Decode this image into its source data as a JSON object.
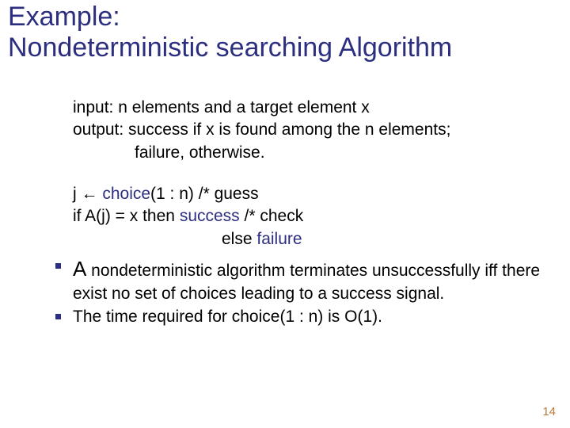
{
  "title_line1": "Example:",
  "title_line2": "Nondeterministic searching Algorithm",
  "io": {
    "input": "input:  n elements and a target element x",
    "output_l1": "output: success if x is found among the n elements;",
    "output_l2": "failure, otherwise."
  },
  "algo": {
    "l1_a": "j ← ",
    "l1_kw": "choice",
    "l1_b": "(1 : n)  /* guess",
    "l2_a": "if A(j) = x then ",
    "l2_kw": "success",
    "l2_b": " /* check",
    "l3_a": "else ",
    "l3_kw": "failure"
  },
  "bullets": {
    "b1_a": "A",
    "b1_b": " nondeterministic algorithm terminates unsuccessfully iff there exist no set of choices leading to a success signal.",
    "b2": "The time required for choice(1 : n) is O(1)."
  },
  "page_number": "14"
}
